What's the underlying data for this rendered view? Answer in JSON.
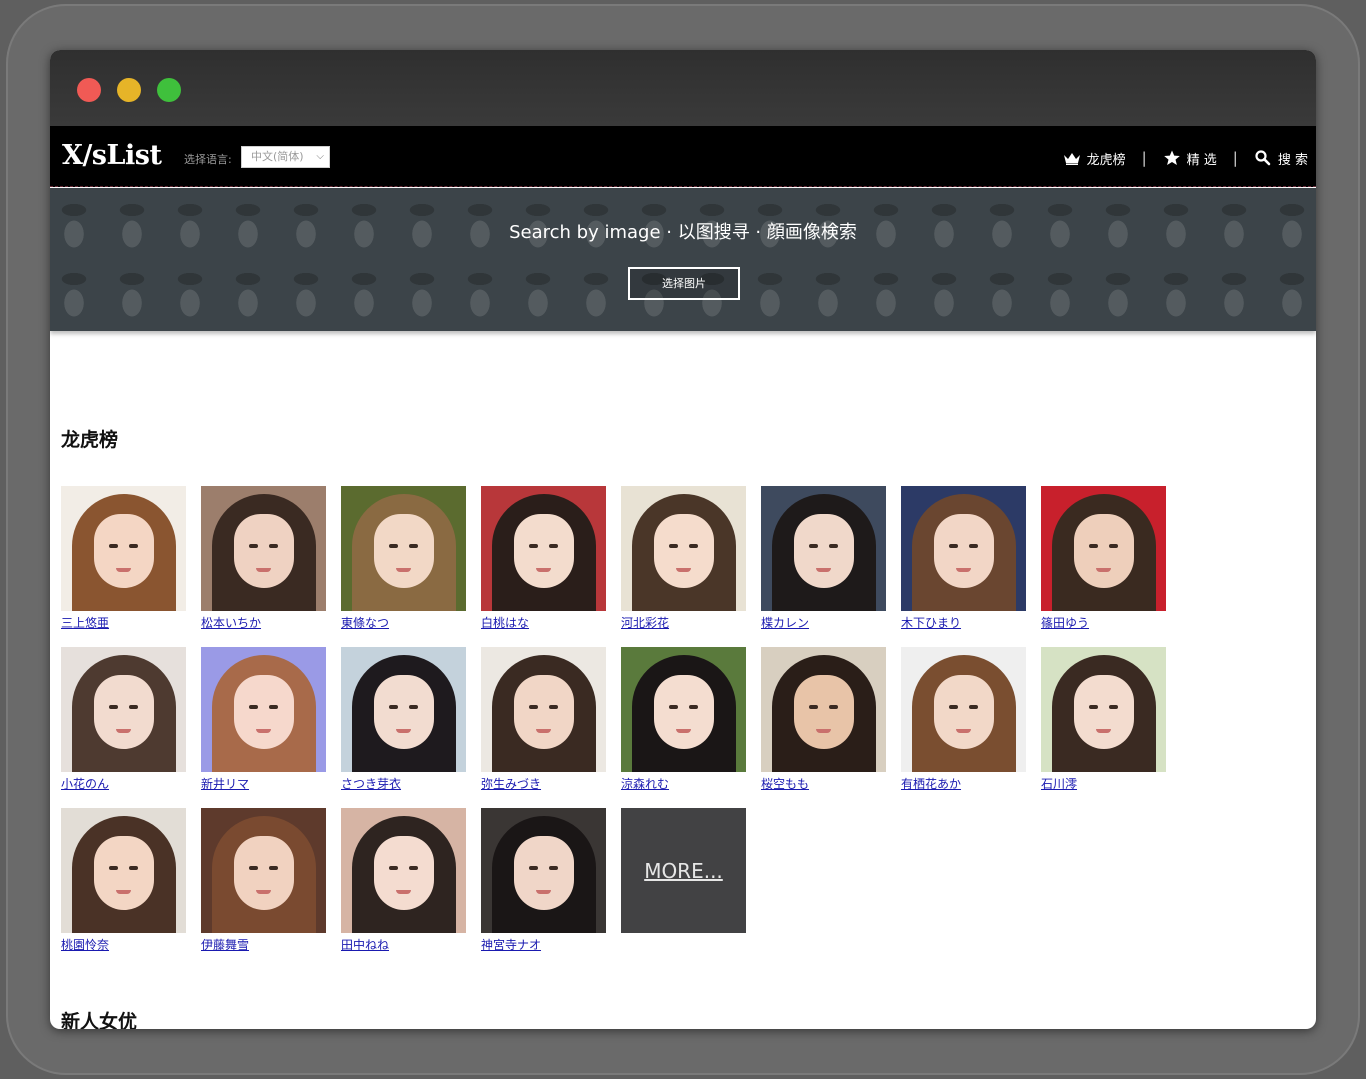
{
  "navbar": {
    "logo": "X/sList",
    "lang_label": "选择语言:",
    "lang_selected": "中文(简体)",
    "links": [
      {
        "label": "龙虎榜",
        "icon": "crown-icon"
      },
      {
        "label": "精 选",
        "icon": "star-icon"
      },
      {
        "label": "搜 索",
        "icon": "search-icon"
      }
    ],
    "separator": "|"
  },
  "hero": {
    "title": "Search by image · 以图搜寻 · 顔画像検索",
    "button_label": "选择图片"
  },
  "sections": {
    "ranking_title": "龙虎榜",
    "newcomer_title": "新人女优"
  },
  "actresses": [
    {
      "name": "三上悠亜",
      "bg": "#f2ede6",
      "hair": "#8a5530",
      "skin": "#f4d6c4"
    },
    {
      "name": "松本いちか",
      "bg": "#9c7e6c",
      "hair": "#3a2a22",
      "skin": "#efd2c2"
    },
    {
      "name": "東條なつ",
      "bg": "#5b6b2f",
      "hair": "#8a6a42",
      "skin": "#f2d8c6"
    },
    {
      "name": "白桃はな",
      "bg": "#b8373a",
      "hair": "#2a1e1a",
      "skin": "#f3dccd"
    },
    {
      "name": "河北彩花",
      "bg": "#e8e2d4",
      "hair": "#4a3628",
      "skin": "#f5dccc"
    },
    {
      "name": "楪カレン",
      "bg": "#3e4a5e",
      "hair": "#1e1a1a",
      "skin": "#f0d8ca"
    },
    {
      "name": "木下ひまり",
      "bg": "#2c3a66",
      "hair": "#6a4630",
      "skin": "#f2d6c6"
    },
    {
      "name": "篠田ゆう",
      "bg": "#c8202c",
      "hair": "#3a2a20",
      "skin": "#eecfbb"
    },
    {
      "name": "小花のん",
      "bg": "#e6e0dc",
      "hair": "#4e3a30",
      "skin": "#f2dbcf"
    },
    {
      "name": "新井リマ",
      "bg": "#9a9ae6",
      "hair": "#a86a4a",
      "skin": "#f6d8cc"
    },
    {
      "name": "さつき芽衣",
      "bg": "#c4d2dc",
      "hair": "#1e1a1e",
      "skin": "#f2dcd0"
    },
    {
      "name": "弥生みづき",
      "bg": "#ece8e2",
      "hair": "#3a2a22",
      "skin": "#f1d6c6"
    },
    {
      "name": "涼森れむ",
      "bg": "#5a7a3c",
      "hair": "#1a1616",
      "skin": "#f4ddd0"
    },
    {
      "name": "桜空もも",
      "bg": "#d8cfc0",
      "hair": "#2a1e18",
      "skin": "#e8c4a8"
    },
    {
      "name": "有栖花あか",
      "bg": "#efefef",
      "hair": "#7a4e30",
      "skin": "#f2d8c8"
    },
    {
      "name": "石川澪",
      "bg": "#d6e2c4",
      "hair": "#3a2a22",
      "skin": "#f3dccf"
    },
    {
      "name": "桃園怜奈",
      "bg": "#e2ddd6",
      "hair": "#4a3226",
      "skin": "#f3d6c4"
    },
    {
      "name": "伊藤舞雪",
      "bg": "#5e3a2c",
      "hair": "#7a4a30",
      "skin": "#f1d2c0"
    },
    {
      "name": "田中ねね",
      "bg": "#d6b4a4",
      "hair": "#2e2420",
      "skin": "#f4dcd0"
    },
    {
      "name": "神宮寺ナオ",
      "bg": "#3a3634",
      "hair": "#1a1616",
      "skin": "#f0d6c8"
    }
  ],
  "more_label": "MORE..."
}
